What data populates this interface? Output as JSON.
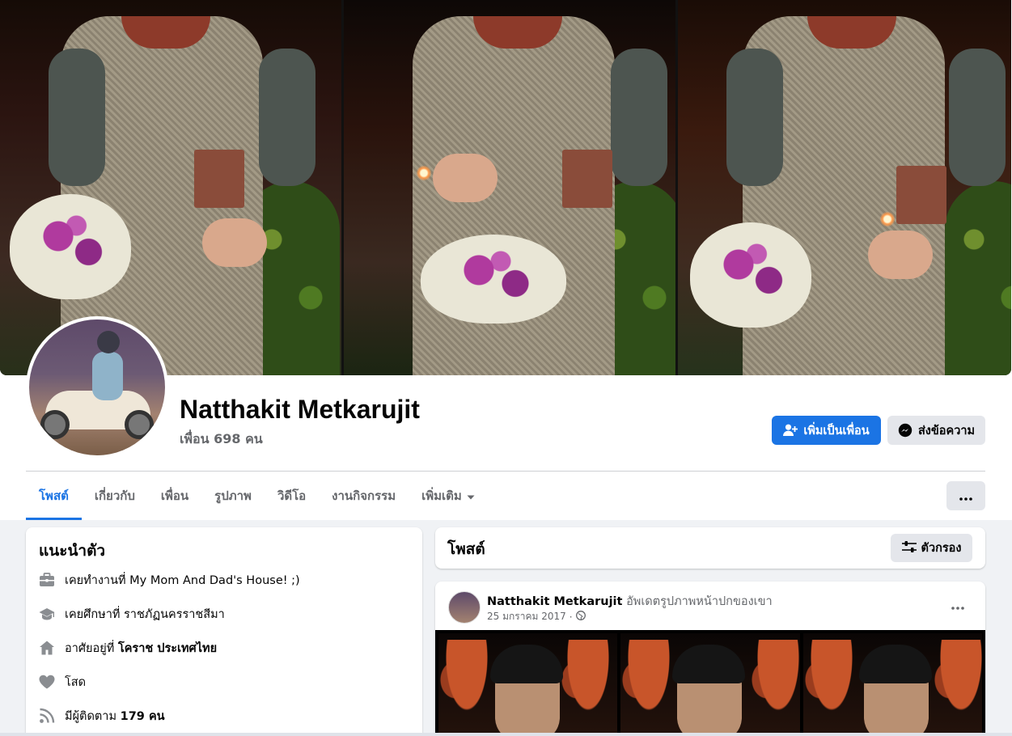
{
  "profile": {
    "name": "Natthakit Metkarujit",
    "friends_count": "เพื่อน 698 คน"
  },
  "actions": {
    "add_friend": "เพิ่มเป็นเพื่อน",
    "message": "ส่งข้อความ"
  },
  "tabs": [
    {
      "label": "โพสต์",
      "active": true
    },
    {
      "label": "เกี่ยวกับ",
      "active": false
    },
    {
      "label": "เพื่อน",
      "active": false
    },
    {
      "label": "รูปภาพ",
      "active": false
    },
    {
      "label": "วิดีโอ",
      "active": false
    },
    {
      "label": "งานกิจกรรม",
      "active": false
    },
    {
      "label": "เพิ่มเติม",
      "active": false
    }
  ],
  "intro": {
    "title": "แนะนำตัว",
    "work_prefix": "เคยทำงานที่",
    "work_value": "My Mom And Dad's House! ;)",
    "education_prefix": "เคยศึกษาที่",
    "education_value": "ราชภัฏนครราชสีมา",
    "lives_prefix": "อาศัยอยู่ที่",
    "lives_value": "โคราช ประเทศไทย",
    "relationship": "โสด",
    "followers_prefix": "มีผู้ติดตาม",
    "followers_value": "179 คน"
  },
  "posts": {
    "title": "โพสต์",
    "filter_label": "ตัวกรอง"
  },
  "post": {
    "author": "Natthakit Metkarujit",
    "action": "อัพเดตรูปภาพหน้าปกของเขา",
    "date": "25 มกราคม 2017",
    "separator": "·"
  },
  "colors": {
    "accent": "#1b74e4",
    "background": "#f0f2f5",
    "card": "#ffffff",
    "secondary_text": "#65676b",
    "button_gray": "#e4e6eb"
  },
  "icons": {
    "add_friend": "person-plus-icon",
    "message": "messenger-icon",
    "more": "ellipsis-icon",
    "dropdown": "caret-down-icon",
    "filter": "sliders-icon",
    "work": "briefcase-icon",
    "education": "graduation-cap-icon",
    "home": "house-icon",
    "relationship": "heart-icon",
    "followers": "rss-icon",
    "privacy": "globe-icon"
  }
}
